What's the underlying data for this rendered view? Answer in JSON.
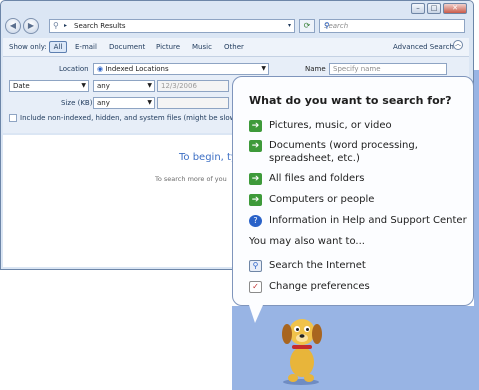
{
  "window": {
    "controls": [
      "–",
      "□",
      "✕"
    ],
    "address": "Search Results",
    "search_placeholder": "Search"
  },
  "filters": {
    "label": "Show only:",
    "options": [
      "All",
      "E-mail",
      "Document",
      "Picture",
      "Music",
      "Other"
    ],
    "advanced": "Advanced Search"
  },
  "panel": {
    "location_label": "Location",
    "location_value": "Indexed Locations",
    "name_label": "Name",
    "name_placeholder": "Specify name",
    "date_value": "Date",
    "date_op": "any",
    "date_field": "12/3/2006",
    "size_label": "Size (KB)",
    "size_op": "any",
    "include_label": "Include non-indexed, hidden, and system files (might be slow)"
  },
  "results": {
    "begin_text": "To begin, ty",
    "search_more_text": "To search more of you"
  },
  "assistant": {
    "heading": "What do you want to search for?",
    "options": [
      "Pictures, music, or video",
      "Documents (word processing, spreadsheet, etc.)",
      "All files and folders",
      "Computers or people",
      "Information in Help and Support Center"
    ],
    "also_label": "You may also want to...",
    "also_options": [
      "Search the Internet",
      "Change preferences"
    ]
  },
  "colors": {
    "window_bg": "#dbe6f4",
    "balloon_bg": "#fcfdff",
    "desktop_blue": "#98b4e4",
    "arrow_green": "#3e9a3a"
  }
}
